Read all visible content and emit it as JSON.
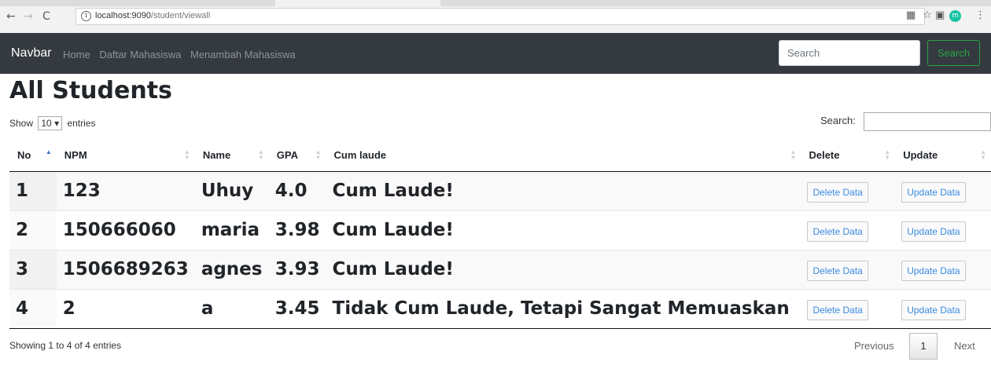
{
  "browser": {
    "url_host": "localhost:9090",
    "url_path": "/student/viewall",
    "avatar_letter": "m"
  },
  "navbar": {
    "brand": "Navbar",
    "links": [
      "Home",
      "Daftar Mahasiswa",
      "Menambah Mahasiswa"
    ],
    "search_placeholder": "Search",
    "search_button": "Search",
    "accent_color": "#28a745"
  },
  "page": {
    "title": "All Students",
    "show_label": "Show",
    "entries_value": "10",
    "entries_label": "entries",
    "search_label": "Search:"
  },
  "table": {
    "columns": [
      "No",
      "NPM",
      "Name",
      "GPA",
      "Cum laude",
      "Delete",
      "Update"
    ],
    "rows": [
      {
        "no": "1",
        "npm": "123",
        "name": "Uhuy",
        "gpa": "4.0",
        "cum_laude": "Cum Laude!",
        "delete": "Delete Data",
        "update": "Update Data"
      },
      {
        "no": "2",
        "npm": "150666060",
        "name": "maria",
        "gpa": "3.98",
        "cum_laude": "Cum Laude!",
        "delete": "Delete Data",
        "update": "Update Data"
      },
      {
        "no": "3",
        "npm": "1506689263",
        "name": "agnes",
        "gpa": "3.93",
        "cum_laude": "Cum Laude!",
        "delete": "Delete Data",
        "update": "Update Data"
      },
      {
        "no": "4",
        "npm": "2",
        "name": "a",
        "gpa": "3.45",
        "cum_laude": "Tidak Cum Laude, Tetapi Sangat Memuaskan",
        "delete": "Delete Data",
        "update": "Update Data"
      }
    ]
  },
  "footer": {
    "info": "Showing 1 to 4 of 4 entries",
    "previous": "Previous",
    "current_page": "1",
    "next": "Next"
  }
}
